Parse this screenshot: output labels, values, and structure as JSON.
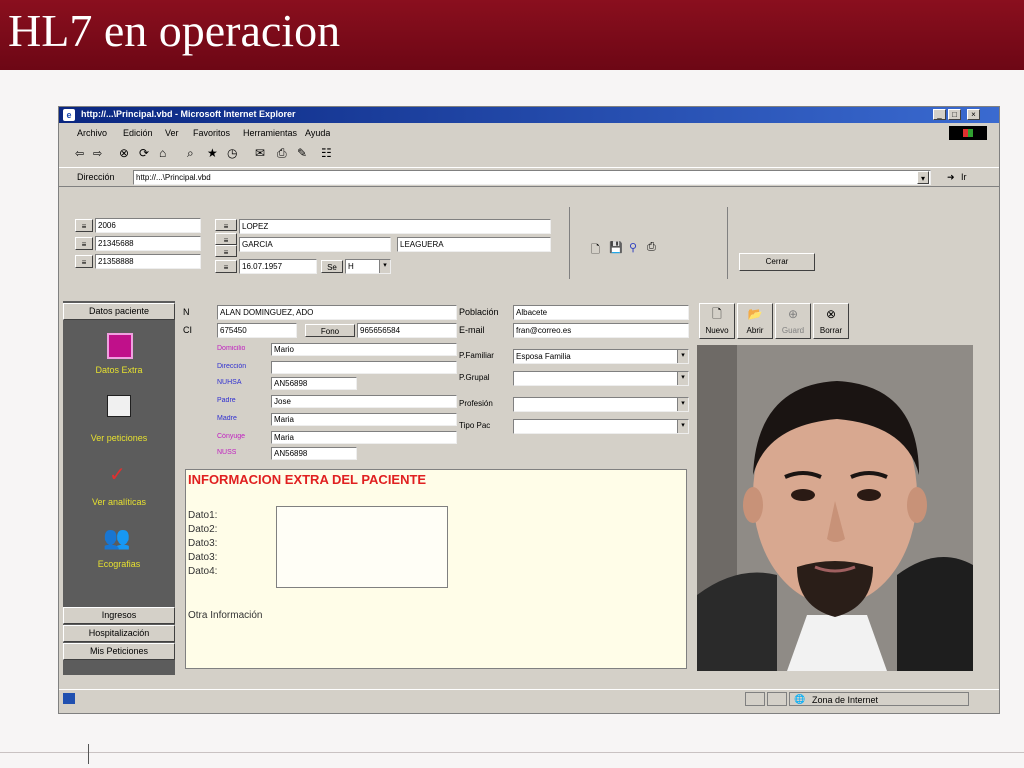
{
  "slide": {
    "title": "HL7 en operacion"
  },
  "browser": {
    "title": "http://...\\Principal.vbd - Microsoft Internet Explorer",
    "menu": [
      "Archivo",
      "Edición",
      "Ver",
      "Favoritos",
      "Herramientas",
      "Ayuda"
    ],
    "address_label": "Dirección",
    "address_value": "http://...\\Principal.vbd",
    "go_label": "Ir",
    "status_zone": "Zona de Internet"
  },
  "header_form": {
    "ids": [
      "2006",
      "21345688",
      "21358888"
    ],
    "surnames": [
      "LOPEZ",
      "GARCIA"
    ],
    "third_field": "LEAGUERA",
    "date": "16.07.1957",
    "sex_label": "Se",
    "sex_value": "H",
    "close_button": "Cerrar"
  },
  "nav": {
    "top_tab": "Datos paciente",
    "items": [
      "Datos Extra",
      "Ver peticiones",
      "Ver analíticas",
      "Ecografias"
    ],
    "bottom_tabs": [
      "Ingresos",
      "Hospitalización",
      "Mis Peticiones"
    ]
  },
  "patient": {
    "name_label": "N",
    "name_value": "ALAN DOMINGUEZ, ADO",
    "ci_label": "CI",
    "ci_value": "675450",
    "phone_label": "Fono",
    "phone_value": "965656584",
    "fields": [
      {
        "label": "Domicilio",
        "value": "Mario"
      },
      {
        "label": "Dirección",
        "value": ""
      },
      {
        "label": "NUHSA",
        "value": "AN56898"
      },
      {
        "label": "Padre",
        "value": "Jose"
      },
      {
        "label": "Madre",
        "value": "Maria"
      },
      {
        "label": "Cónyuge",
        "value": "Maria"
      },
      {
        "label": "NUSS",
        "value": "AN56898"
      }
    ],
    "right_fields": [
      {
        "label": "Población",
        "value": "Albacete"
      },
      {
        "label": "E-mail",
        "value": "fran@correo.es"
      }
    ],
    "combos": [
      {
        "label": "P.Familiar",
        "value": "Esposa Familia"
      },
      {
        "label": "P.Grupal",
        "value": ""
      },
      {
        "label": "Profesión",
        "value": ""
      },
      {
        "label": "Tipo Pac",
        "value": ""
      }
    ]
  },
  "extra": {
    "heading": "INFORMACION EXTRA DEL PACIENTE",
    "data_lines": [
      "Dato1:",
      "Dato2:",
      "Dato3:",
      "Dato3:",
      "Dato4:"
    ],
    "other_info": "Otra Información"
  },
  "photo_toolbar": [
    "Nuevo",
    "Abrir",
    "Guard",
    "Borrar"
  ],
  "colors": {
    "header": "#7a0a18",
    "window_bg": "#d4d0c8",
    "extra_heading": "#e02020",
    "nav_text": "#e6e030"
  }
}
